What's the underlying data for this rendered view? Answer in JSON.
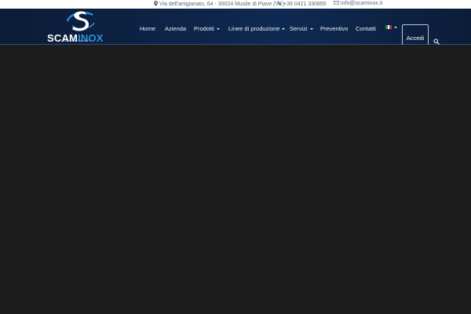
{
  "topbar": {
    "address": "Via dell'artigianato, 64 - 30024 Musile di Piave (VE)",
    "phone": "+39 0421 330855",
    "email": "info@scaminox.it"
  },
  "logo": {
    "brand_part1": "SCAM",
    "brand_part2": "INOX",
    "tagline": "INNOVATION QUALITY"
  },
  "nav": {
    "items": [
      {
        "label": "Home"
      },
      {
        "label": "Azienda"
      },
      {
        "label": "Prodotti"
      },
      {
        "label": "Linee di produzione"
      },
      {
        "label": "Servizi"
      },
      {
        "label": "Preventivo"
      },
      {
        "label": "Contatti"
      }
    ],
    "language_flag": "it-flag-icon",
    "login_label": "Accedi",
    "search_icon": "search-icon"
  },
  "colors": {
    "navbar_bg": "#0e2448",
    "brand_blue": "#2f8fdc",
    "page_bg": "#1c1c1c",
    "flag_green": "#009246",
    "flag_white": "#ffffff",
    "flag_red": "#ce2b37"
  }
}
